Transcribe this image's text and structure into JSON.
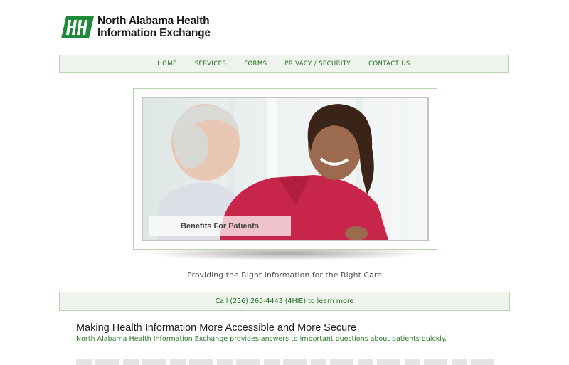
{
  "header": {
    "logo_line1": "North Alabama Health",
    "logo_line2": "Information Exchange"
  },
  "nav": {
    "items": [
      {
        "label": "HOME"
      },
      {
        "label": "SERVICES"
      },
      {
        "label": "FORMS"
      },
      {
        "label": "PRIVACY / SECURITY"
      },
      {
        "label": "CONTACT US"
      }
    ]
  },
  "hero": {
    "caption": "Benefits For Patients"
  },
  "tagline": "Providing the Right Information for the Right Care",
  "callbar": "Call (256) 265-4443 (4HIE) to learn more",
  "main": {
    "headline": "Making Health Information More Accessible and More Secure",
    "subline": "North Alabama Health Information Exchange provides answers to important questions about patients quickly."
  },
  "colors": {
    "brand_green": "#1f8a3a",
    "nav_text": "#1f6b1f",
    "bar_bg": "#eef4ec",
    "bar_border": "#b7d3b0"
  }
}
